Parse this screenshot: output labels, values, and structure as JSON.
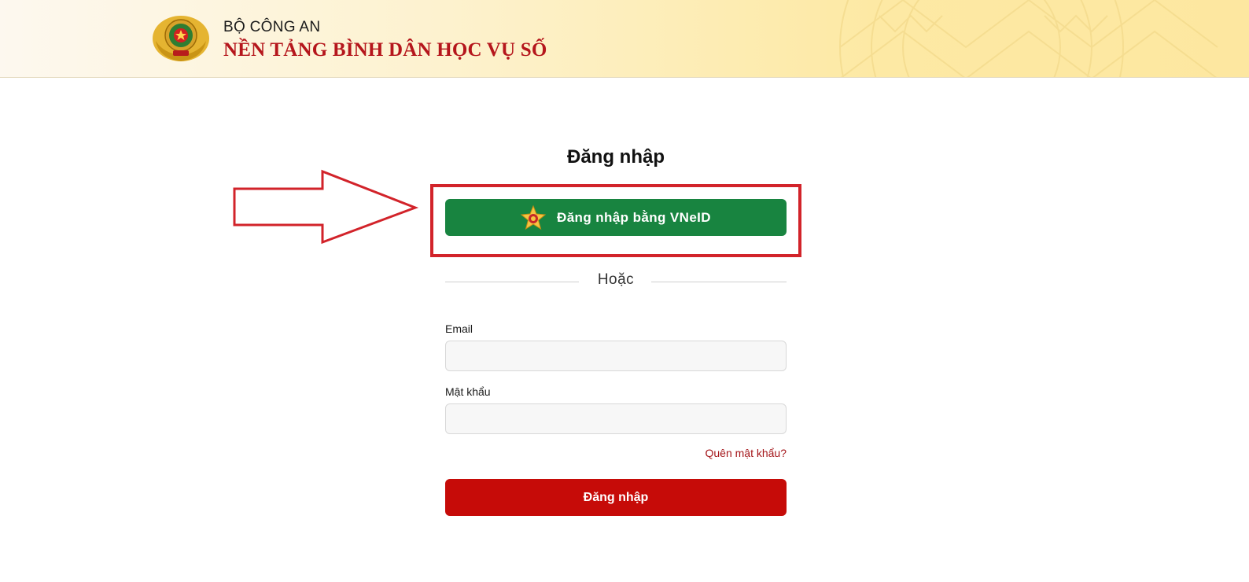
{
  "header": {
    "ministry": "BỘ CÔNG AN",
    "platform": "NỀN TẢNG BÌNH DÂN HỌC VỤ SỐ",
    "emblem_icon": "police-emblem-icon"
  },
  "login": {
    "title": "Đăng nhập",
    "vneid_label": "Đăng nhập bằng VNeID",
    "vneid_icon": "vneid-star-icon",
    "divider_text": "Hoặc",
    "email_label": "Email",
    "email_value": "",
    "email_placeholder": "",
    "password_label": "Mật khẩu",
    "password_value": "",
    "password_placeholder": "",
    "forgot_label": "Quên mật khẩu?",
    "submit_label": "Đăng nhập"
  },
  "annotation": {
    "arrow_icon": "arrow-right-outline-icon"
  },
  "colors": {
    "vneid_green": "#188440",
    "submit_red": "#c60b08",
    "highlight_red": "#d2232a",
    "platform_red": "#b5161c",
    "link_red": "#a4161a"
  }
}
